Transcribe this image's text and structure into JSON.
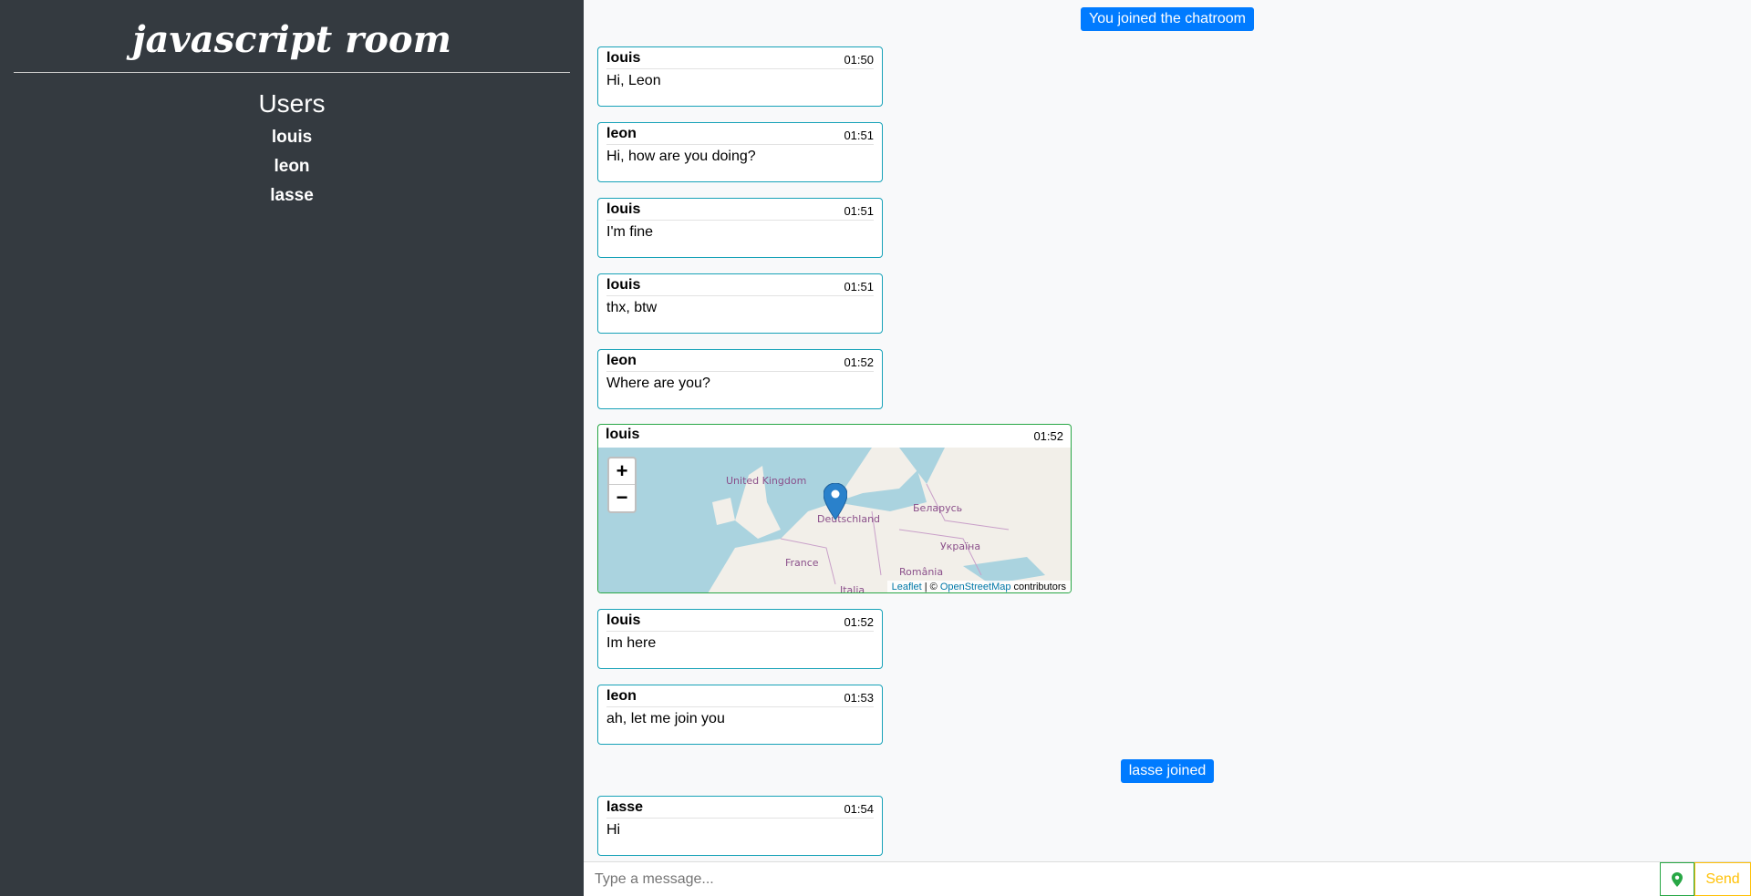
{
  "sidebar": {
    "room_title": "javascript room",
    "users_title": "Users",
    "users": [
      "louis",
      "leon",
      "lasse"
    ]
  },
  "notices": {
    "joined": "You joined the chatroom",
    "lasse": "lasse joined"
  },
  "messages": [
    {
      "name": "louis",
      "time": "01:50",
      "text": "Hi, Leon"
    },
    {
      "name": "leon",
      "time": "01:51",
      "text": "Hi, how are you doing?"
    },
    {
      "name": "louis",
      "time": "01:51",
      "text": "I'm fine"
    },
    {
      "name": "louis",
      "time": "01:51",
      "text": "thx, btw"
    },
    {
      "name": "leon",
      "time": "01:52",
      "text": "Where are you?"
    },
    {
      "name": "louis",
      "time": "01:52",
      "type": "location"
    },
    {
      "name": "louis",
      "time": "01:52",
      "text": "Im here"
    },
    {
      "name": "leon",
      "time": "01:53",
      "text": "ah, let me join you"
    },
    {
      "name": "lasse",
      "time": "01:54",
      "text": "Hi"
    }
  ],
  "map": {
    "zoom_in": "+",
    "zoom_out": "−",
    "labels": [
      "United Kingdom",
      "Deutschland",
      "Беларусь",
      "Україна",
      "France",
      "România",
      "Italia"
    ],
    "attribution": {
      "leaflet": "Leaflet",
      "sep": " | © ",
      "osm": "OpenStreetMap",
      "rest": " contributors"
    },
    "marker_icon": "map-marker-icon"
  },
  "input": {
    "placeholder": "Type a message...",
    "send_label": "Send",
    "location_icon": "map-pin-icon"
  },
  "colors": {
    "sidebar": "#343a40",
    "notice": "#007bff",
    "card_border": "#17a2b8",
    "map_border": "#28a745",
    "send": "#ffc107"
  }
}
